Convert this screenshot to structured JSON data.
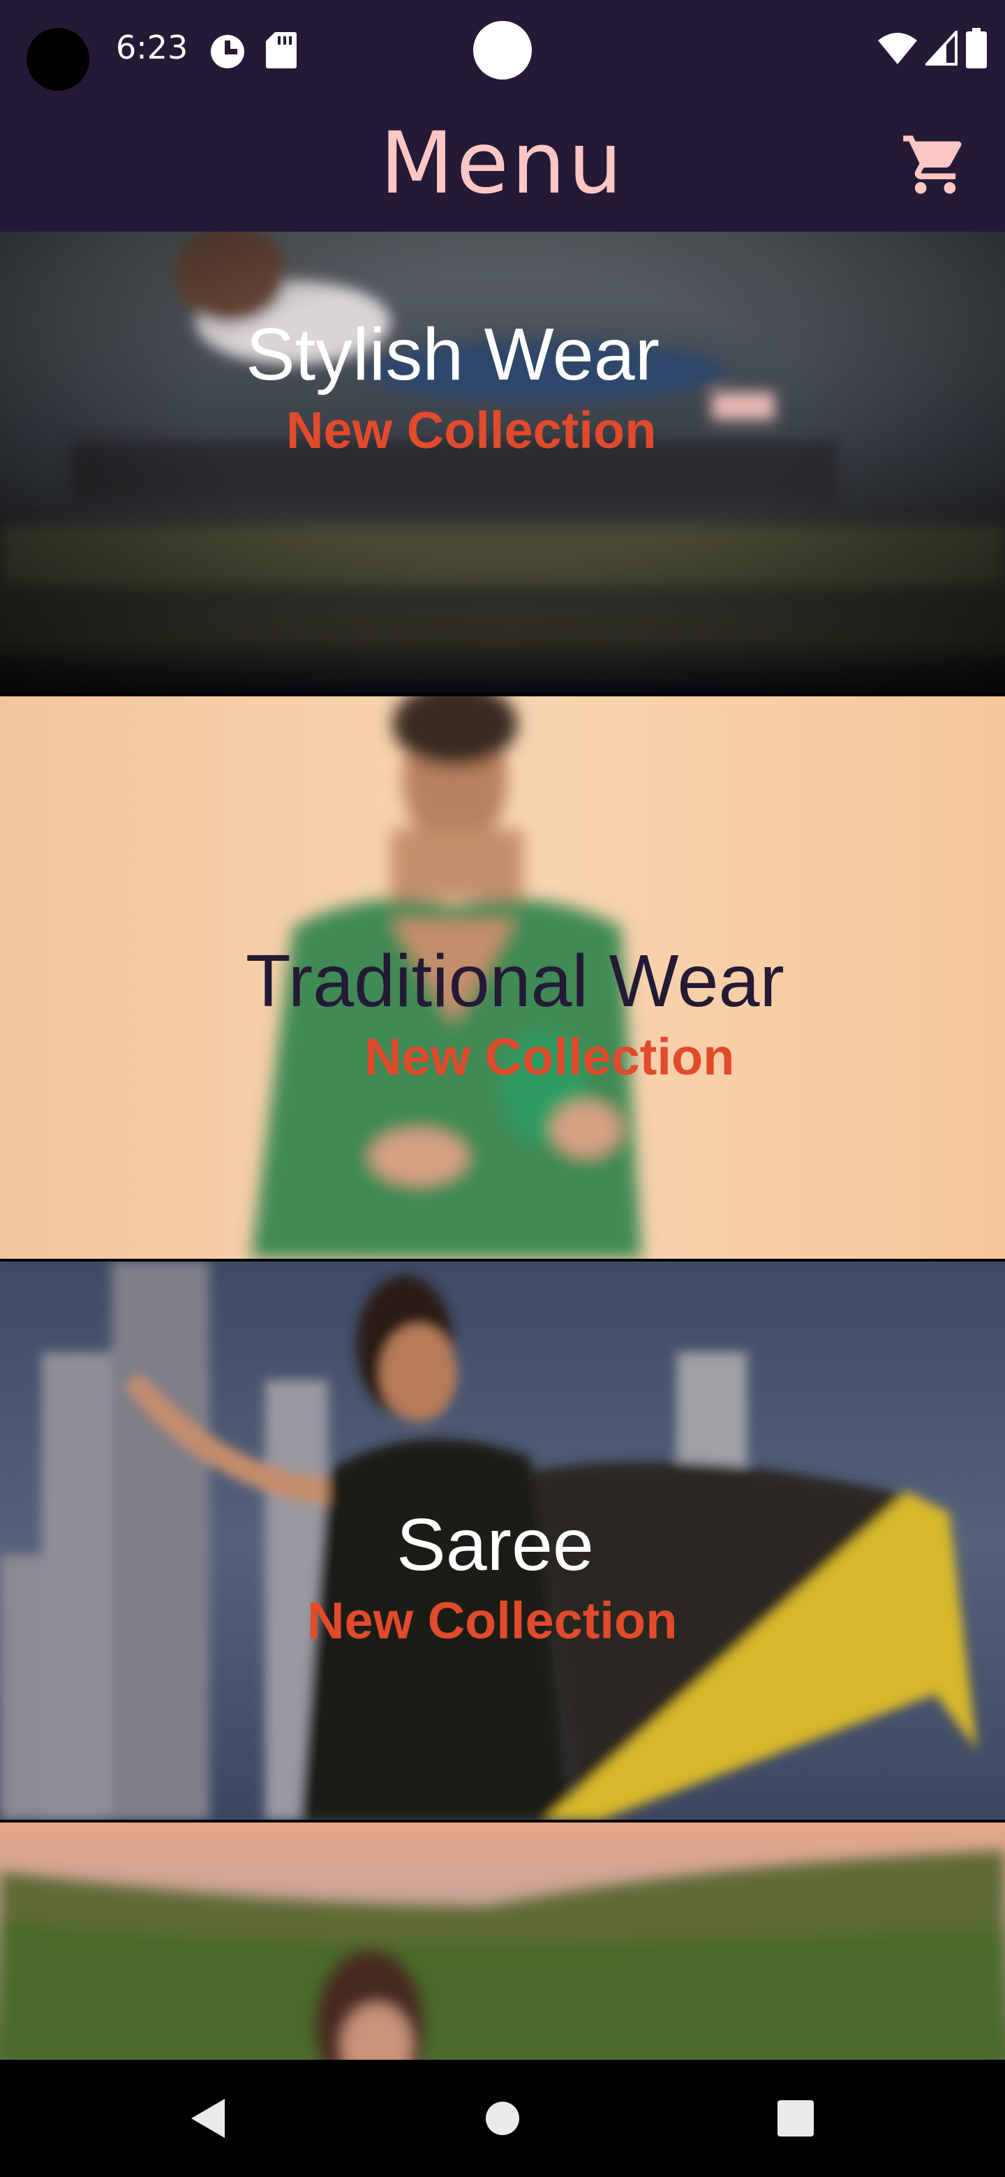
{
  "status_bar": {
    "time": "6:23",
    "icons": [
      "camera-cutout",
      "data-saver-icon",
      "sd-card-icon",
      "wifi-icon",
      "cell-signal-icon",
      "battery-icon"
    ]
  },
  "app_bar": {
    "title": "Menu",
    "cart_icon": "shopping-cart-icon"
  },
  "colors": {
    "bar_background": "#241a36",
    "title_color": "#ffc7c4",
    "subtitle_color": "#e24a2c",
    "light_text": "#ffffff",
    "dark_text": "#241a36"
  },
  "categories": [
    {
      "title": "Stylish Wear",
      "subtitle": "New Collection"
    },
    {
      "title": "Traditional Wear",
      "subtitle": "New Collection"
    },
    {
      "title": "Saree",
      "subtitle": "New Collection"
    },
    {
      "title": "",
      "subtitle": ""
    }
  ],
  "nav_bar": {
    "buttons": [
      "back-icon",
      "home-icon",
      "recents-icon"
    ]
  }
}
